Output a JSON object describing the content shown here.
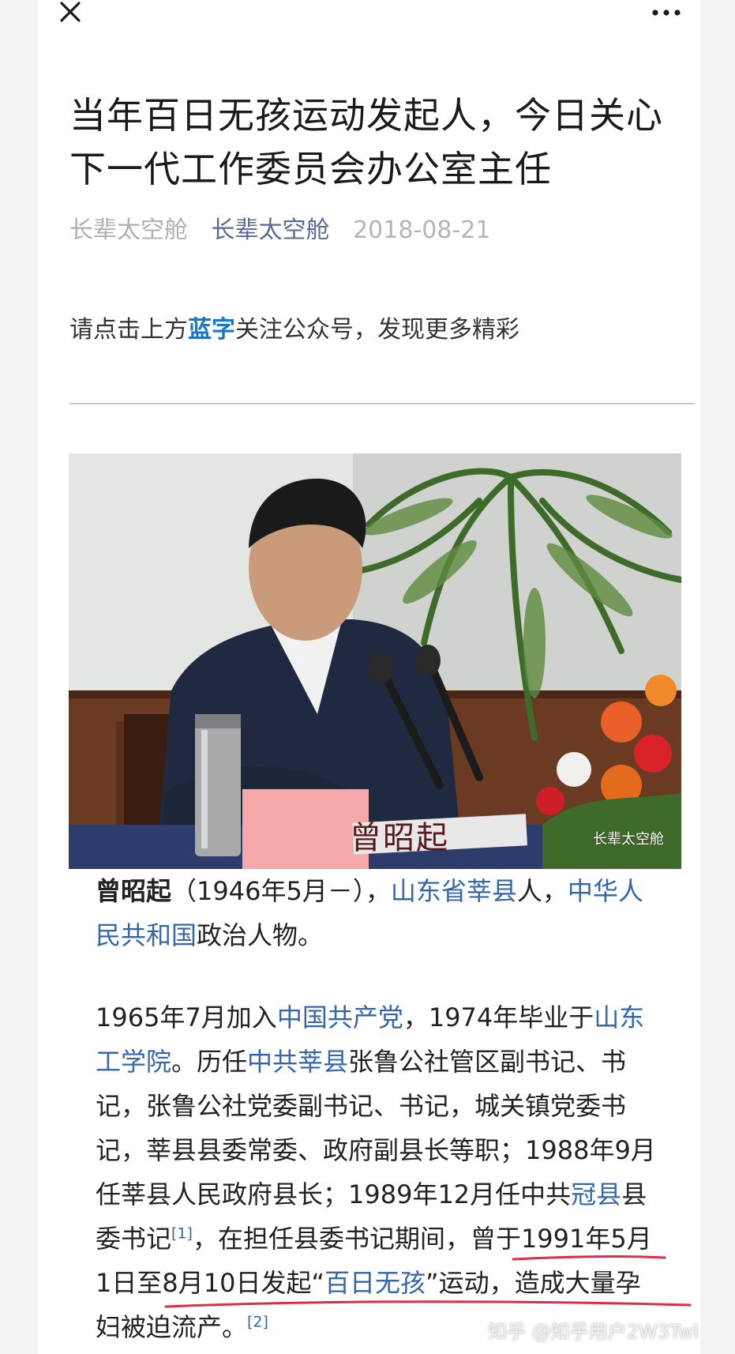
{
  "header": {
    "close_icon": "close-icon",
    "more_icon": "more-icon"
  },
  "article": {
    "title": "当年百日无孩运动发起人，今日关心下一代工作委员会办公室主任",
    "author": "长辈太空舱",
    "account": "长辈太空舱",
    "date": "2018-08-21",
    "prompt_before": "请点击上方",
    "prompt_link": "蓝字",
    "prompt_after": "关注公众号，发现更多精彩"
  },
  "photo": {
    "nameplate": "曾昭起",
    "watermark": "长辈太空舱"
  },
  "wiki": {
    "p1": {
      "name": "曾昭起",
      "dates": "（1946年5月－），",
      "link1": "山东省莘县",
      "t1": "人，",
      "link2": "中华人民共和国",
      "t2": "政治人物。"
    },
    "p2": {
      "t1": "1965年7月加入",
      "link1": "中国共产党",
      "t2": "，1974年毕业于",
      "link2": "山东工学院",
      "t3": "。历任",
      "link3": "中共莘县",
      "t4": "张鲁公社管区副书记、书记，张鲁公社党委副书记、书记，城关镇党委书记，莘县县委常委、政府副县长等职；1988年9月任莘县人民政府县长；1989年12月任中共",
      "link4": "冠县",
      "t5": "县委书记",
      "ref1": "[1]",
      "t6": "，在担任县委书记期间，曾于1991年5月1日至8月10日发起“",
      "link5": "百日无孩",
      "t7": "”运动，造成大量孕妇被迫流产。",
      "ref2": "[2]"
    }
  },
  "overlay": {
    "zhihu_watermark": "知乎 @知乎用户2W3Twl",
    "underline_color": "#d8304a"
  }
}
